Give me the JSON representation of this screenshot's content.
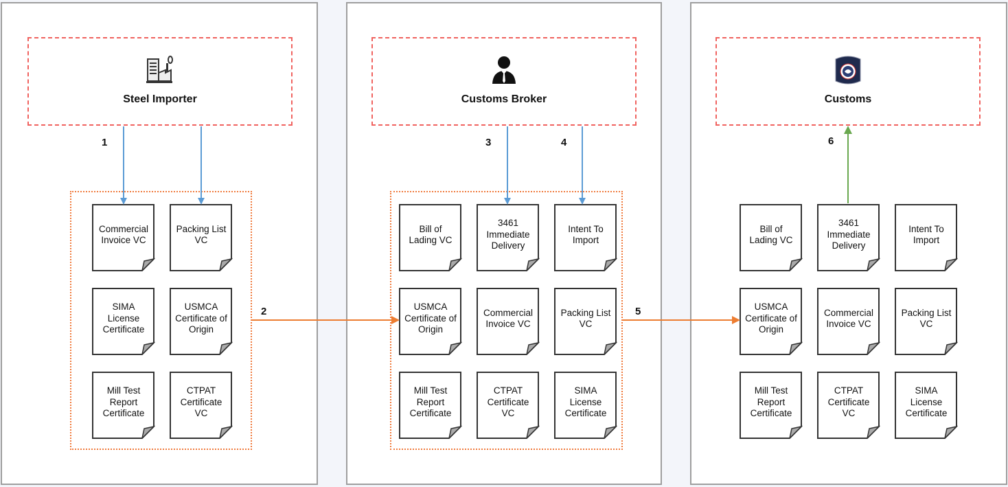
{
  "colors": {
    "request_arrow": "#5b9bd5",
    "transfer_arrow": "#ed7d31",
    "verify_arrow": "#6aa84f",
    "header_border": "#f0625f",
    "group_border": "#f07a3c"
  },
  "actors": [
    {
      "name": "Steel Importer",
      "icon": "factory-icon"
    },
    {
      "name": "Customs Broker",
      "icon": "person-icon"
    },
    {
      "name": "Customs",
      "icon": "cbp-badge-icon"
    }
  ],
  "steps": [
    "1",
    "2",
    "3",
    "4",
    "5",
    "6"
  ],
  "documents": [
    [
      [
        "Commercial\nInvoice VC",
        "Packing List\nVC"
      ],
      [
        "SIMA\nLicense\nCertificate",
        "USMCA\nCertificate of\nOrigin"
      ],
      [
        "Mill Test\nReport\nCertificate",
        "CTPAT\nCertificate\nVC"
      ]
    ],
    [
      [
        "Bill of\nLading VC",
        "3461\nImmediate\nDelivery",
        "Intent To\nImport"
      ],
      [
        "USMCA\nCertificate of\nOrigin",
        "Commercial\nInvoice VC",
        "Packing List\nVC"
      ],
      [
        "Mill Test\nReport\nCertificate",
        "CTPAT\nCertificate\nVC",
        "SIMA\nLicense\nCertificate"
      ]
    ],
    [
      [
        "Bill of\nLading VC",
        "3461\nImmediate\nDelivery",
        "Intent To\nImport"
      ],
      [
        "USMCA\nCertificate of\nOrigin",
        "Commercial\nInvoice VC",
        "Packing List\nVC"
      ],
      [
        "Mill Test\nReport\nCertificate",
        "CTPAT\nCertificate\nVC",
        "SIMA\nLicense\nCertificate"
      ]
    ]
  ]
}
